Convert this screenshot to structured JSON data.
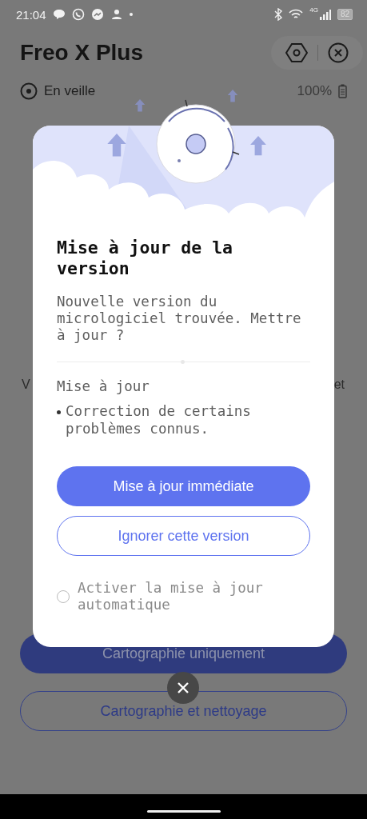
{
  "status_bar": {
    "time": "21:04",
    "network": "4G",
    "battery": "82"
  },
  "header": {
    "title": "Freo X Plus"
  },
  "robot_status": {
    "state": "En veille",
    "battery": "100%"
  },
  "background_fragments": [
    "V",
    "et"
  ],
  "background_buttons": [
    {
      "label": "Cartographie uniquement",
      "kind": "filled"
    },
    {
      "label": "Cartographie et nettoyage",
      "kind": "outline"
    }
  ],
  "dialog": {
    "title": "Mise à jour de la version",
    "message": "Nouvelle version du micrologiciel trouvée. Mettre à jour ?",
    "section_title": "Mise à jour",
    "notes": [
      "Correction de certains problèmes connus."
    ],
    "buttons": [
      {
        "label": "Mise à jour immédiate",
        "kind": "primary"
      },
      {
        "label": "Ignorer cette version",
        "kind": "secondary"
      }
    ],
    "auto_update": {
      "label": "Activer la mise à jour automatique",
      "checked": false
    }
  }
}
